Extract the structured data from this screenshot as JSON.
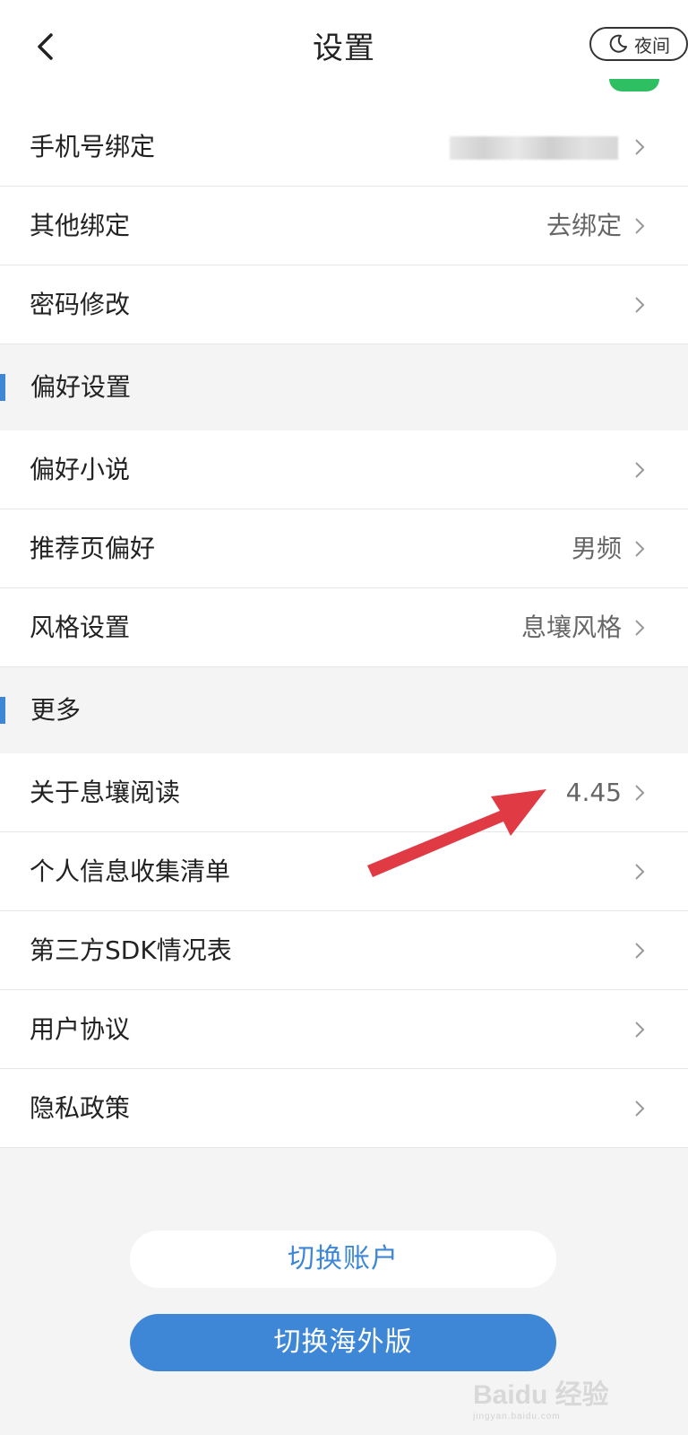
{
  "header": {
    "title": "设置",
    "night_label": "夜间"
  },
  "rows_top": [
    {
      "label": "手机号绑定",
      "value": "",
      "blurred": true
    },
    {
      "label": "其他绑定",
      "value": "去绑定"
    },
    {
      "label": "密码修改",
      "value": ""
    }
  ],
  "section_pref": {
    "label": "偏好设置"
  },
  "rows_pref": [
    {
      "label": "偏好小说",
      "value": ""
    },
    {
      "label": "推荐页偏好",
      "value": "男频"
    },
    {
      "label": "风格设置",
      "value": "息壤风格"
    }
  ],
  "section_more": {
    "label": "更多"
  },
  "rows_more": [
    {
      "label": "关于息壤阅读",
      "value": "4.45"
    },
    {
      "label": "个人信息收集清单",
      "value": ""
    },
    {
      "label": "第三方SDK情况表",
      "value": ""
    },
    {
      "label": "用户协议",
      "value": ""
    },
    {
      "label": "隐私政策",
      "value": ""
    }
  ],
  "buttons": {
    "switch_account": "切换账户",
    "switch_overseas": "切换海外版"
  },
  "watermark": {
    "main": "Baidu 经验",
    "sub": "jingyan.baidu.com"
  },
  "colors": {
    "accent": "#3e87d6",
    "arrow": "#e03a45",
    "green_indicator": "#2fbf63"
  }
}
